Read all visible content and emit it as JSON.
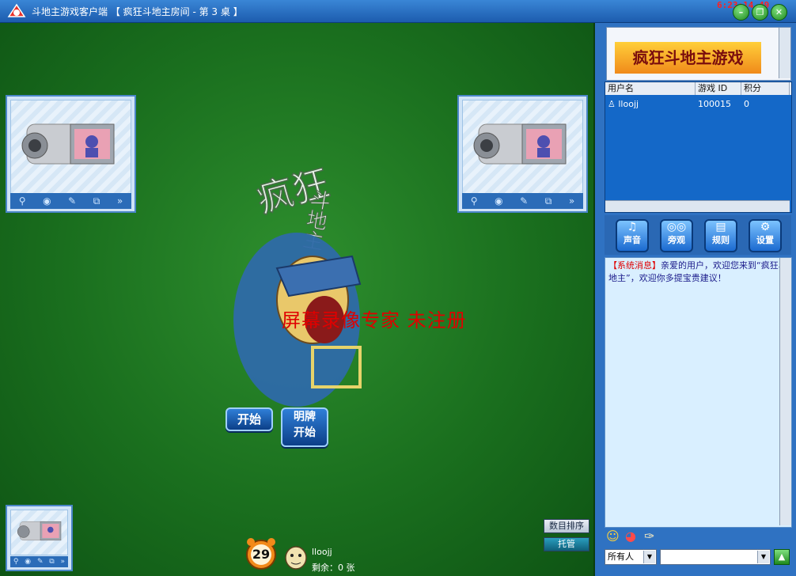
{
  "titlebar": {
    "app_name": "斗地主游戏客户端",
    "room": "【 疯狂斗地主房间 - 第 3 桌 】",
    "clock": "6:23:14.49"
  },
  "table": {
    "logo_text": {
      "line1": "疯狂",
      "line2": "斗地主"
    },
    "watermark": "屏幕录像专家 未注册",
    "start_button": "开始",
    "show_start_button_line1": "明牌",
    "show_start_button_line2": "开始",
    "sort_button": "数目排序",
    "auto_button": "托管"
  },
  "player": {
    "timer": "29",
    "name": "lloojj",
    "remaining_label": "剩余：0 张"
  },
  "sidebar": {
    "ad_text": "疯狂斗地主游戏",
    "user_table": {
      "headers": [
        "用户名",
        "游戏 ID",
        "积分"
      ],
      "rows": [
        {
          "name": "lloojj",
          "id": "100015",
          "score": "0"
        }
      ]
    },
    "icon_buttons": [
      "声音",
      "旁观",
      "规则",
      "设置"
    ],
    "chat": {
      "system_tag": "【系统消息】",
      "message": "亲爱的用户，欢迎您来到“疯狂斗地主”，欢迎你多提宝贵建议！"
    },
    "target_select": "所有人",
    "message_input": ""
  }
}
